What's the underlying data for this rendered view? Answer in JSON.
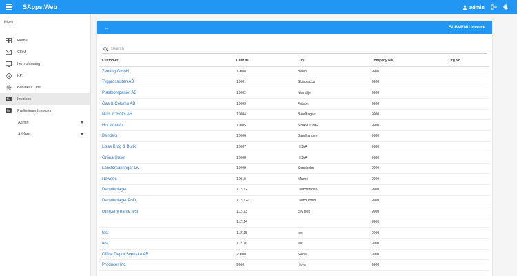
{
  "app": {
    "title": "SApps.Web",
    "user": "admin"
  },
  "colors": {
    "primary": "#2196f3",
    "link": "#2a73c6"
  },
  "sidebar": {
    "menu_label": "Menu",
    "items": [
      {
        "label": "Home",
        "icon": "home-icon"
      },
      {
        "label": "CRM",
        "icon": "mail-icon"
      },
      {
        "label": "Item planning",
        "icon": "tv-icon"
      },
      {
        "label": "KPI",
        "icon": "check-circle-icon"
      },
      {
        "label": "Business Ops",
        "icon": "gear-icon"
      },
      {
        "label": "Invoices",
        "icon": "invoice-icon",
        "active": true
      },
      {
        "label": "Preliminary Invoices",
        "icon": "invoice-icon"
      }
    ],
    "groups": [
      {
        "label": "Admin"
      },
      {
        "label": "Addons"
      }
    ]
  },
  "panel": {
    "title": "SUBMENU.Invoice"
  },
  "search": {
    "placeholder": "Search",
    "value": ""
  },
  "table": {
    "columns": [
      "Customer",
      "Cust ID",
      "City",
      "Company No.",
      "Org No."
    ],
    "rows": [
      [
        "Zeeting GmbH",
        "10000",
        "Berlin",
        "9900",
        ""
      ],
      [
        "Tyggrossisten AB",
        "10001",
        "Skärblacka",
        "9900",
        ""
      ],
      [
        "Plastkompaniet AB",
        "10002",
        "Norrtälje",
        "9900",
        ""
      ],
      [
        "Gas & Column AB",
        "10003",
        "Frösön",
        "9900",
        ""
      ],
      [
        "Nuts 'n' Bolts AB",
        "10004",
        "Bandhagen",
        "9900",
        ""
      ],
      [
        "Hot Wheelz",
        "10005",
        "SHANDONG",
        "9900",
        ""
      ],
      [
        "Benders",
        "10006",
        "Bandhangen",
        "9900",
        ""
      ],
      [
        "Lisas Krog & Butik",
        "10007",
        "HOVA",
        "9900",
        ""
      ],
      [
        "Gröna Huset",
        "10008",
        "HOVA",
        "9900",
        ""
      ],
      [
        "Länsförsäkringar Liv",
        "10009",
        "Stockholm",
        "9900",
        ""
      ],
      [
        "Newsec",
        "10010",
        "Malmö",
        "9900",
        ""
      ],
      [
        "Demobolaget",
        "112112",
        "Demostaden",
        "9900",
        ""
      ],
      [
        "Demobolaget PoD",
        "112112-1",
        "Demo orten",
        "9900",
        ""
      ],
      [
        "company name test",
        "112113",
        "city test",
        "9900",
        ""
      ],
      [
        "",
        "112114",
        "",
        "9900",
        ""
      ],
      [
        "test",
        "112115",
        "test",
        "9900",
        ""
      ],
      [
        "test",
        "112116",
        "test",
        "9900",
        ""
      ],
      [
        "Office Depot Svenska AB",
        "20000",
        "Solna",
        "9900",
        ""
      ],
      [
        "Producer Inc.",
        "9900",
        "Hova",
        "9900",
        ""
      ]
    ]
  }
}
